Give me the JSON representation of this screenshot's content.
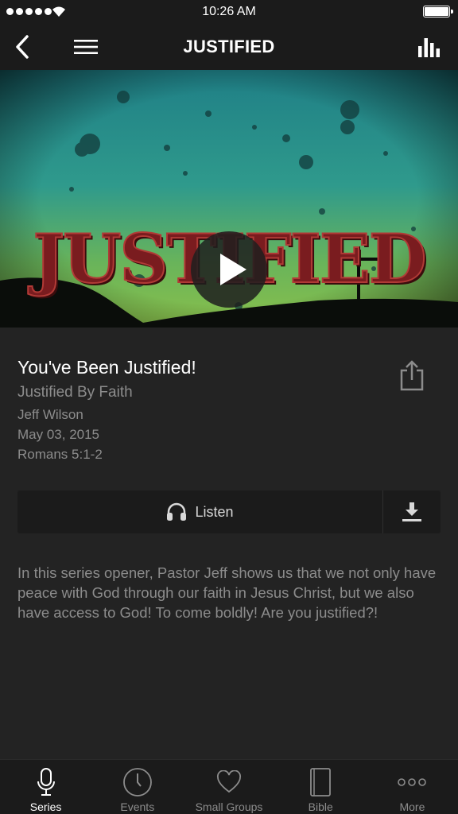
{
  "status_bar": {
    "time": "10:26 AM"
  },
  "nav": {
    "title": "JUSTIFIED"
  },
  "hero": {
    "artwork_title": "JUSTIFIED"
  },
  "sermon": {
    "title": "You've Been Justified!",
    "series": "Justified By Faith",
    "speaker": "Jeff Wilson",
    "date": "May 03, 2015",
    "scripture": "Romans 5:1-2"
  },
  "actions": {
    "listen_label": "Listen"
  },
  "description": "In this series opener, Pastor Jeff shows us that we not only have peace with God through our faith in Jesus Christ, but we also have access to God!  To come boldly!  Are you justified?!",
  "tabs": [
    {
      "label": "Series",
      "icon": "microphone-icon",
      "active": true
    },
    {
      "label": "Events",
      "icon": "clock-icon",
      "active": false
    },
    {
      "label": "Small Groups",
      "icon": "heart-icon",
      "active": false
    },
    {
      "label": "Bible",
      "icon": "book-icon",
      "active": false
    },
    {
      "label": "More",
      "icon": "more-icon",
      "active": false
    }
  ],
  "colors": {
    "background": "#232323",
    "bar": "#1b1b1b",
    "muted_text": "#8c8c8c",
    "art_red": "#7a1c1f",
    "art_teal": "#2f8f8a"
  }
}
